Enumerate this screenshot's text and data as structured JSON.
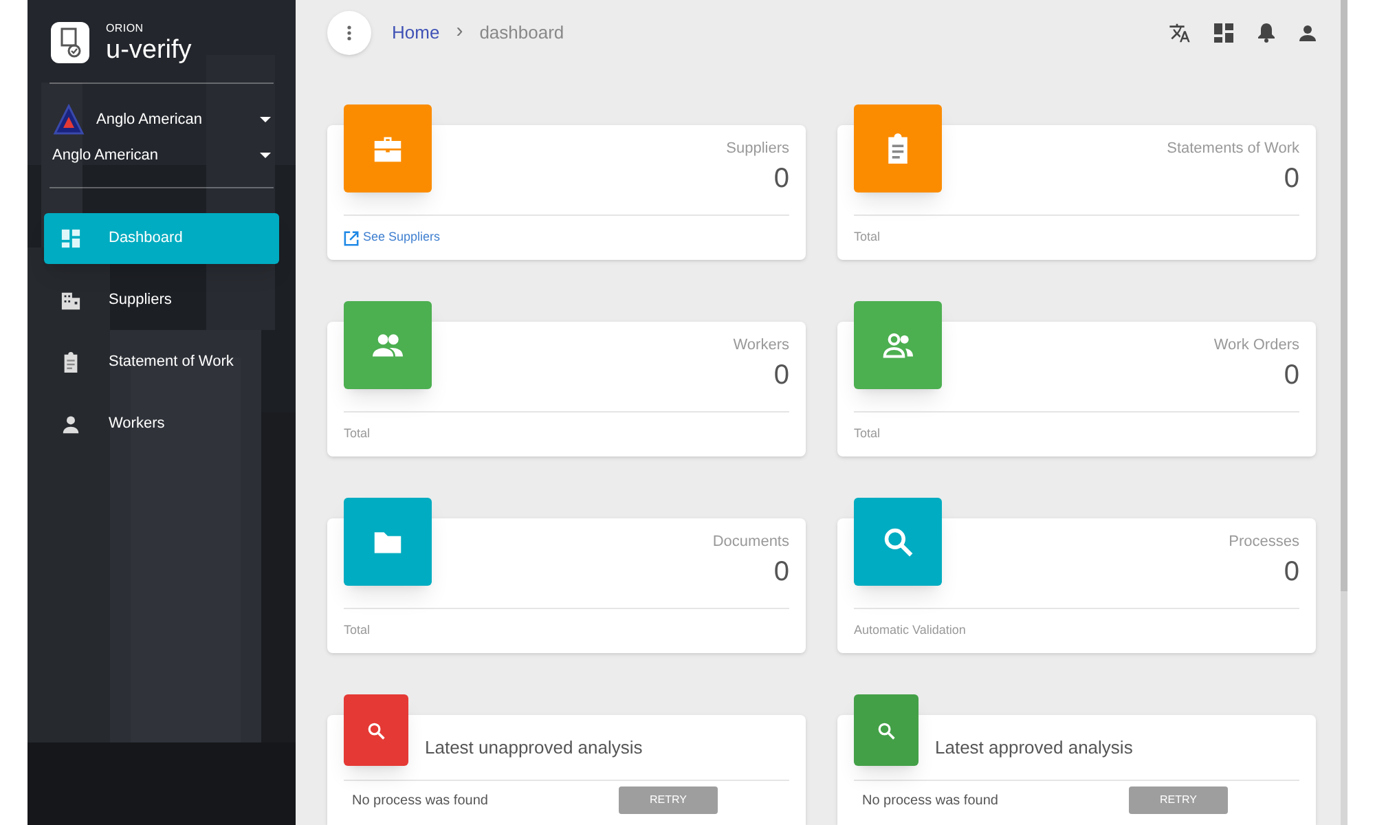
{
  "brand": {
    "subtitle": "ORION",
    "title": "u-verify"
  },
  "organization": {
    "primary": "Anglo American",
    "secondary": "Anglo American"
  },
  "nav": [
    {
      "label": "Dashboard",
      "selected": true
    },
    {
      "label": "Suppliers",
      "selected": false
    },
    {
      "label": "Statement of Work",
      "selected": false
    },
    {
      "label": "Workers",
      "selected": false
    }
  ],
  "breadcrumb": {
    "home": "Home",
    "separator": "›",
    "current": "dashboard"
  },
  "stats": [
    {
      "label": "Suppliers",
      "value": "0",
      "color": "#fb8c00",
      "footer": {
        "kind": "link",
        "text": "See Suppliers"
      }
    },
    {
      "label": "Statements of Work",
      "value": "0",
      "color": "#fb8c00",
      "footer": {
        "kind": "text",
        "text": "Total"
      }
    },
    {
      "label": "Workers",
      "value": "0",
      "color": "#4caf50",
      "footer": {
        "kind": "text",
        "text": "Total"
      }
    },
    {
      "label": "Work Orders",
      "value": "0",
      "color": "#4caf50",
      "footer": {
        "kind": "text",
        "text": "Total"
      }
    },
    {
      "label": "Documents",
      "value": "0",
      "color": "#00acc1",
      "footer": {
        "kind": "text",
        "text": "Total"
      }
    },
    {
      "label": "Processes",
      "value": "0",
      "color": "#00acc1",
      "footer": {
        "kind": "text",
        "text": "Automatic Validation"
      }
    }
  ],
  "analyses": [
    {
      "title": "Latest unapproved analysis",
      "color": "#e53935",
      "message": "No process was found",
      "button": "RETRY"
    },
    {
      "title": "Latest approved analysis",
      "color": "#43a047",
      "message": "No process was found",
      "button": "RETRY"
    }
  ]
}
